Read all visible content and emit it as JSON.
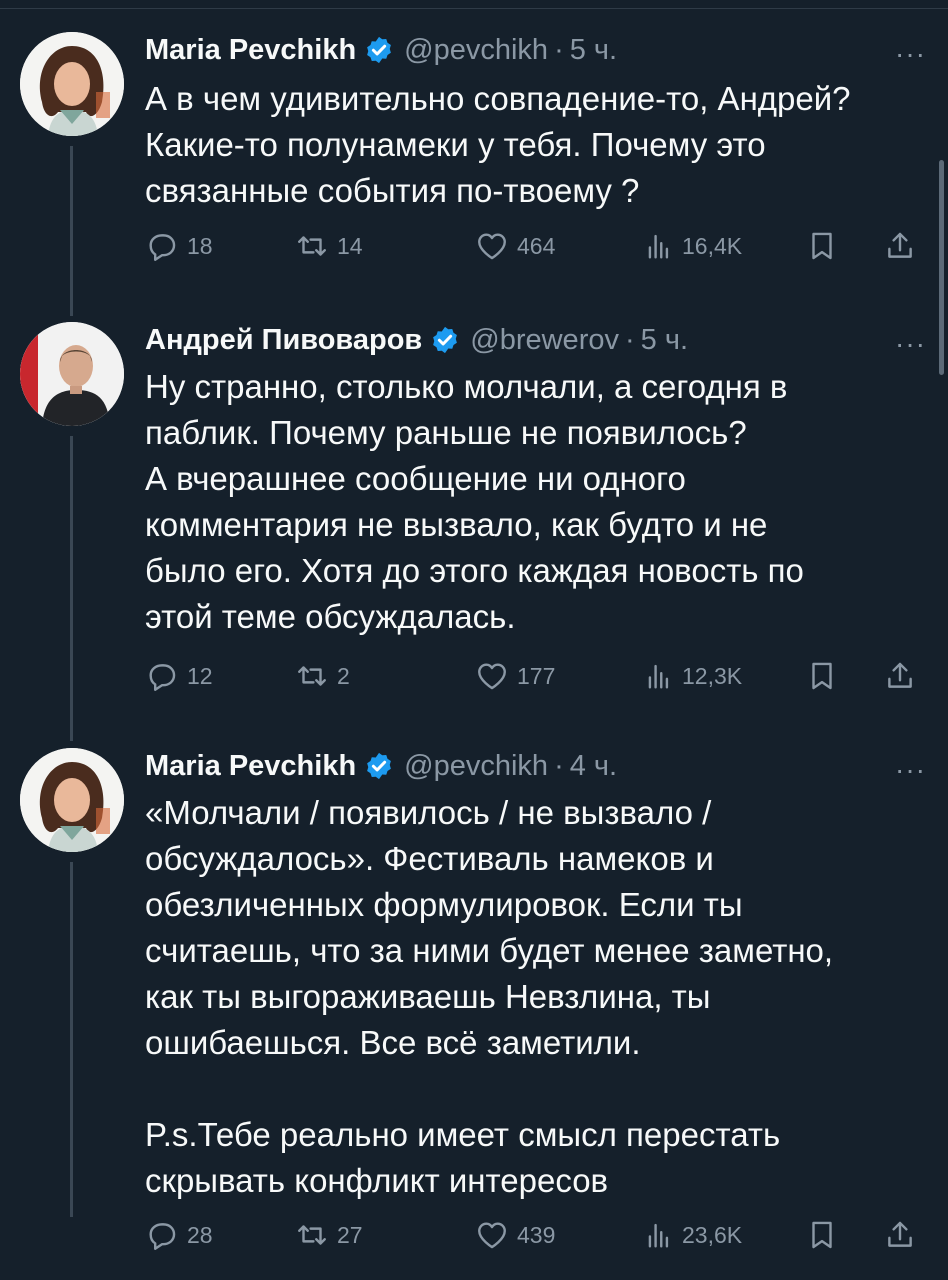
{
  "tweets": [
    {
      "name": "Maria Pevchikh",
      "handle": "@pevchikh",
      "dot": "·",
      "time": "5 ч.",
      "text": "А в чем удивительно совпадение-то, Андрей?\nКакие-то полунамеки у тебя. Почему это\nсвязанные события по-твоему ?",
      "replies": "18",
      "retweets": "14",
      "likes": "464",
      "views": "16,4K"
    },
    {
      "name": "Андрей Пивоваров",
      "handle": "@brewerov",
      "dot": "·",
      "time": "5 ч.",
      "text": "Ну странно, столько молчали, а сегодня в\nпаблик. Почему раньше не появилось?\nА вчерашнее сообщение ни одного\nкомментария не вызвало, как будто и не\nбыло его. Хотя до этого каждая новость по\nэтой теме обсуждалась.",
      "replies": "12",
      "retweets": "2",
      "likes": "177",
      "views": "12,3K"
    },
    {
      "name": "Maria Pevchikh",
      "handle": "@pevchikh",
      "dot": "·",
      "time": "4 ч.",
      "text": "«Молчали / появилось / не вызвало /\nобсуждалось». Фестиваль намеков и\nобезличенных формулировок. Если ты\nсчитаешь, что за ними будет менее заметно,\nкак ты выгораживаешь Невзлина, ты\nошибаешься. Все всё заметили.\n\nP.s.Тебе реально имеет смысл перестать\nскрывать конфликт интересов",
      "replies": "28",
      "retweets": "27",
      "likes": "439",
      "views": "23,6K"
    }
  ],
  "more_label": "···",
  "colors": {
    "background": "#15202b",
    "text": "#f7f9f9",
    "secondary": "#8b98a5",
    "verified": "#1d9bf0",
    "thread_line": "#3a4754"
  },
  "icons": {
    "reply": "reply-icon",
    "retweet": "retweet-icon",
    "like": "heart-icon",
    "views": "views-icon",
    "bookmark": "bookmark-icon",
    "share": "share-icon",
    "verified": "verified-badge-icon",
    "more": "more-icon"
  }
}
